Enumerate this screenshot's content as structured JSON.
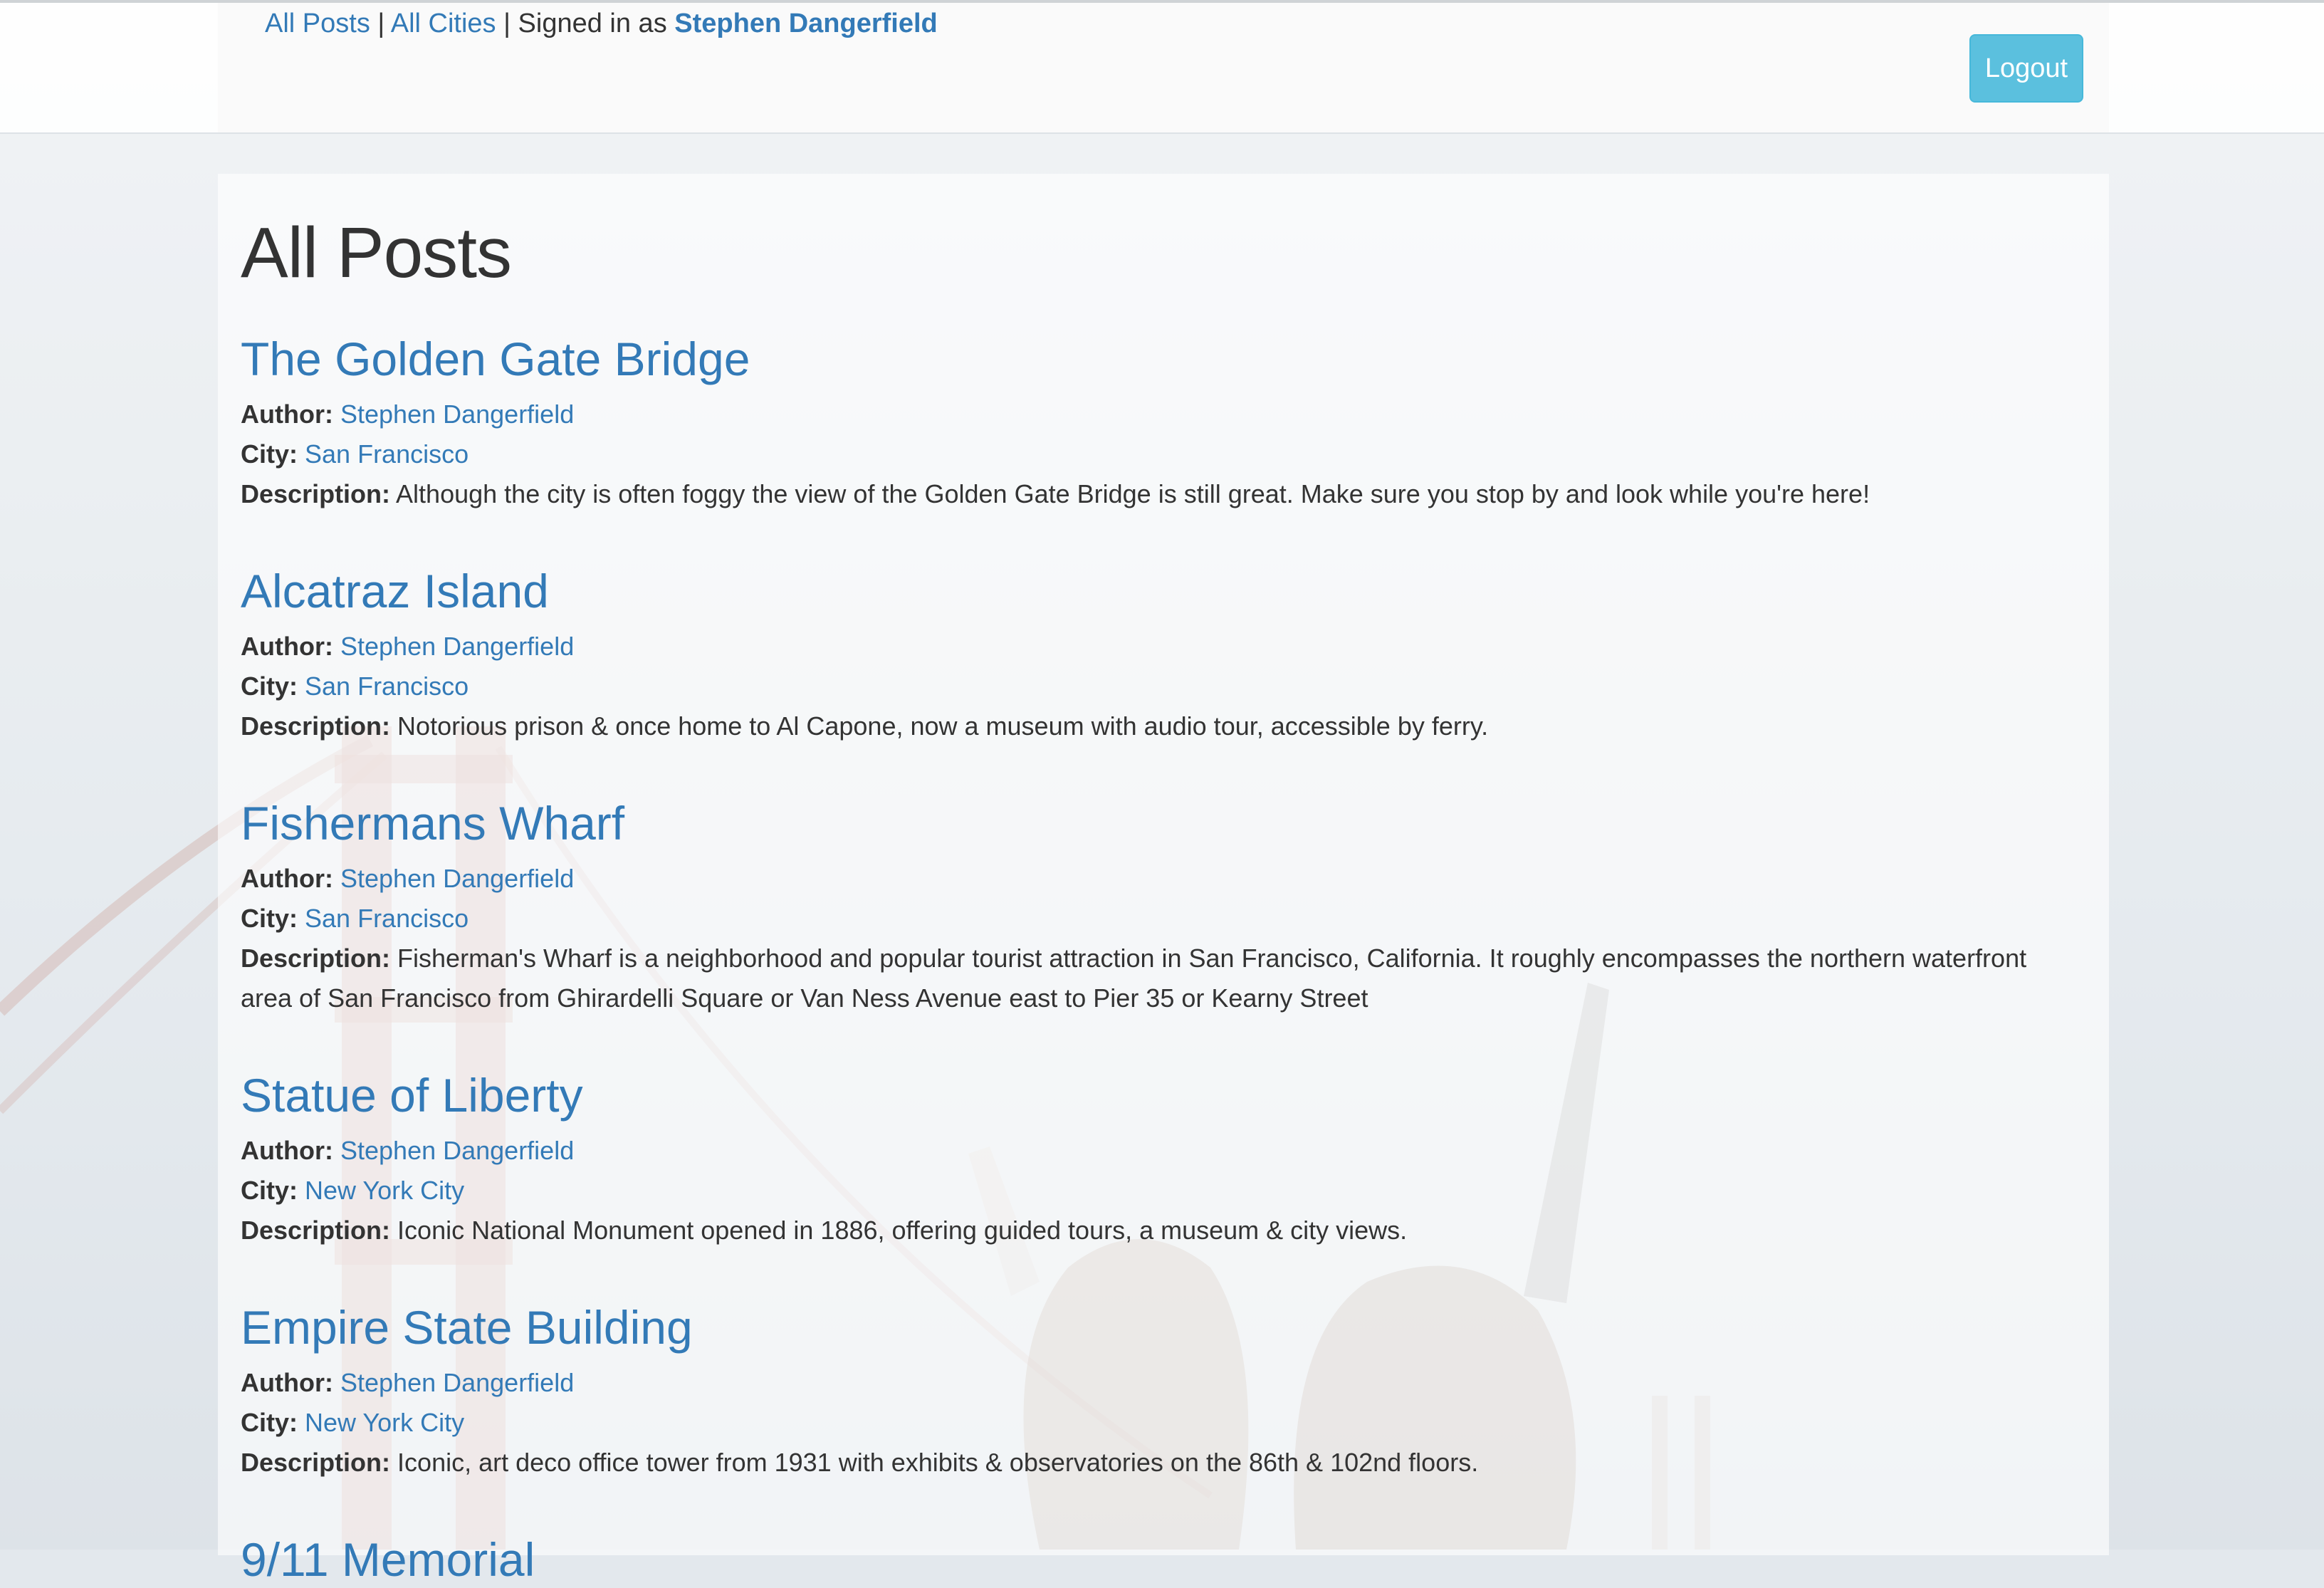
{
  "nav": {
    "all_posts": "All Posts",
    "sep1": "|",
    "all_cities": "All Cities",
    "sep2": "|",
    "signed_in_text": "Signed in as",
    "user": "Stephen Dangerfield",
    "logout": "Logout"
  },
  "main": {
    "title": "All Posts",
    "labels": {
      "author": "Author:",
      "city": "City:",
      "description": "Description:"
    },
    "posts": [
      {
        "title": "The Golden Gate Bridge",
        "author": "Stephen Dangerfield",
        "city": "San Francisco",
        "description": "Although the city is often foggy the view of the Golden Gate Bridge is still great. Make sure you stop by and look while you're here!"
      },
      {
        "title": "Alcatraz Island",
        "author": "Stephen Dangerfield",
        "city": "San Francisco",
        "description": "Notorious prison & once home to Al Capone, now a museum with audio tour, accessible by ferry."
      },
      {
        "title": "Fishermans Wharf",
        "author": "Stephen Dangerfield",
        "city": "San Francisco",
        "description": "Fisherman's Wharf is a neighborhood and popular tourist attraction in San Francisco, California. It roughly encompasses the northern waterfront area of San Francisco from Ghirardelli Square or Van Ness Avenue east to Pier 35 or Kearny Street"
      },
      {
        "title": "Statue of Liberty",
        "author": "Stephen Dangerfield",
        "city": "New York City",
        "description": "Iconic National Monument opened in 1886, offering guided tours, a museum & city views."
      },
      {
        "title": "Empire State Building",
        "author": "Stephen Dangerfield",
        "city": "New York City",
        "description": "Iconic, art deco office tower from 1931 with exhibits & observatories on the 86th & 102nd floors."
      },
      {
        "title": "9/11 Memorial"
      }
    ]
  },
  "colors": {
    "link": "#337ab7",
    "logout_button": "#5bc0de",
    "text": "#333333"
  }
}
